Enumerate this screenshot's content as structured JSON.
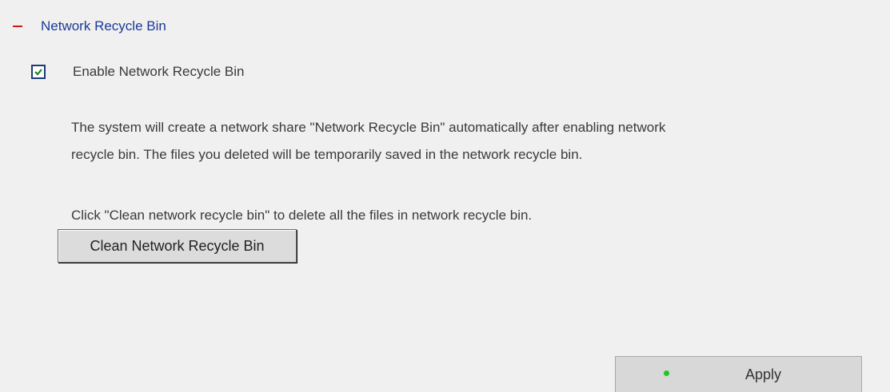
{
  "section": {
    "collapse_icon": "minus-icon",
    "title": "Network Recycle Bin"
  },
  "enable": {
    "checked": true,
    "label": "Enable Network Recycle Bin"
  },
  "description": {
    "line1": "The system will create a network share \"Network Recycle Bin\" automatically after enabling network",
    "line2": "recycle bin. The files you deleted will be temporarily saved in the network recycle bin."
  },
  "clean": {
    "instruction": "Click \"Clean network recycle bin\" to delete all the files in network recycle bin.",
    "button_label": "Clean Network Recycle Bin"
  },
  "apply": {
    "status_icon": "green-dot-icon",
    "label": "Apply"
  },
  "colors": {
    "collapse_icon": "#d01818",
    "section_title": "#1a3a9a",
    "panel_background": "#f0f0f0",
    "status_dot": "#1ec81e"
  }
}
